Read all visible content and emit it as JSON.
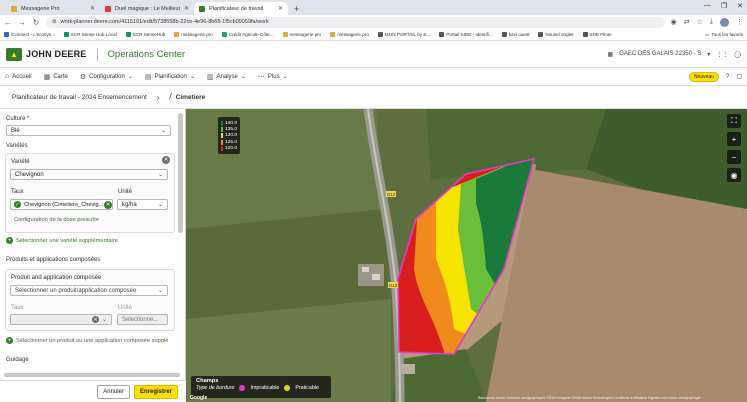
{
  "browser": {
    "tabs": [
      {
        "label": "Messagerie Pro",
        "color": "#e8a33a",
        "active": false
      },
      {
        "label": "Duel magique : Le Meilleur A...",
        "color": "#e53935",
        "active": false
      },
      {
        "label": "Planificateur de travail",
        "color": "#367c2b",
        "active": true
      }
    ],
    "url": "work-planner.deere.com/4115101/edit/5738558b-22ce-4e96-8b65-1f5cb09059fa/work",
    "bookmarks": [
      {
        "label": "iConnect - L'écosys...",
        "color": "#2a6ebd"
      },
      {
        "label": "SCR Sense Hub Local",
        "color": "#1b8f5a"
      },
      {
        "label": "SCR SenseHub",
        "color": "#1b8f5a"
      },
      {
        "label": "messagerie.pro",
        "color": "#e8a33a"
      },
      {
        "label": "Crédit Agricole Côte...",
        "color": "#2f9a6c"
      },
      {
        "label": "messagerie pro",
        "color": "#e8a33a"
      },
      {
        "label": "messagerie.pro",
        "color": "#e8a33a"
      },
      {
        "label": "MON PORTAIL by E...",
        "color": "#555555"
      },
      {
        "label": "Portail SIDE - Identifi...",
        "color": "#555555"
      },
      {
        "label": "bsvi ouest",
        "color": "#555555"
      },
      {
        "label": "Nouvel onglet",
        "color": "#555555"
      },
      {
        "label": "SDE Pilote",
        "color": "#555555"
      }
    ],
    "all_bookmarks": "Tous les favoris"
  },
  "header": {
    "brand": "JOHN DEERE",
    "app": "Operations Center",
    "org": "GAEC DES GALAIS 22350 - S"
  },
  "nav": {
    "items": [
      {
        "label": "Accueil",
        "icon": "home-icon",
        "glyph": "⌂"
      },
      {
        "label": "Carte",
        "icon": "map-icon",
        "glyph": "▦"
      },
      {
        "label": "Configuration",
        "icon": "config-icon",
        "glyph": "⚙",
        "dropdown": true
      },
      {
        "label": "Planification",
        "icon": "planning-icon",
        "glyph": "▤",
        "dropdown": true
      },
      {
        "label": "Analyse",
        "icon": "analysis-icon",
        "glyph": "▥",
        "dropdown": true
      },
      {
        "label": "Plus",
        "icon": "more-icon",
        "glyph": "⋯",
        "dropdown": true
      }
    ],
    "new_badge": "Nouveau"
  },
  "breadcrumb": {
    "parent": "Planificateur de travail - 2024 Ensemencement",
    "current": "Cimetiere"
  },
  "panel": {
    "culture_label": "Culture *",
    "culture_value": "Blé",
    "varietes_title": "Variétés",
    "variete_label": "Variété",
    "variete_value": "Chevignon",
    "taux_label": "Taux",
    "taux_value": "Chevignon (Cimetiere_Chevig...",
    "unite_label": "Unité",
    "unite_value": "kg/ha",
    "config_link": "Configuration de la dose prescrite",
    "add_variete": "Sélectionner une variété supplémentaire",
    "produits_title": "Produits et applications composées",
    "produit_label": "Produit and application composée",
    "produit_placeholder": "Sélectionner un produit/application composée",
    "taux2_label": "Taux",
    "unite2_label": "Unité",
    "unite2_placeholder": "Sélectionne...",
    "add_produit": "Sélectionner un produit ou une application composée supplé",
    "guidage_title": "Guidage",
    "cancel": "Annuler",
    "save": "Enregistrer"
  },
  "map": {
    "legend": [
      {
        "value": "140.0",
        "color": "#1a7a3a"
      },
      {
        "value": "135.0",
        "color": "#6abf3a"
      },
      {
        "value": "130.0",
        "color": "#f5e400"
      },
      {
        "value": "125.0",
        "color": "#f08a1c"
      },
      {
        "value": "120.0",
        "color": "#d81e1e"
      }
    ],
    "tools": [
      {
        "name": "fullscreen-icon",
        "glyph": "⛶"
      },
      {
        "name": "zoom-in-icon",
        "glyph": "+"
      },
      {
        "name": "zoom-out-icon",
        "glyph": "−"
      },
      {
        "name": "locate-icon",
        "glyph": "◉"
      }
    ],
    "road_labels": [
      "D12",
      "D12"
    ],
    "champs_title": "Champs",
    "champs_sub": "Type de bordure",
    "impracticable": "Impraticable",
    "praticable": "Praticable",
    "google": "Google",
    "attribution": "Raccourcis clavier   Données cartographiques ©2024 Imagerie ©2024 Airbus Technologies   Conditions d'utilisation   Signaler une erreur cartographique"
  }
}
